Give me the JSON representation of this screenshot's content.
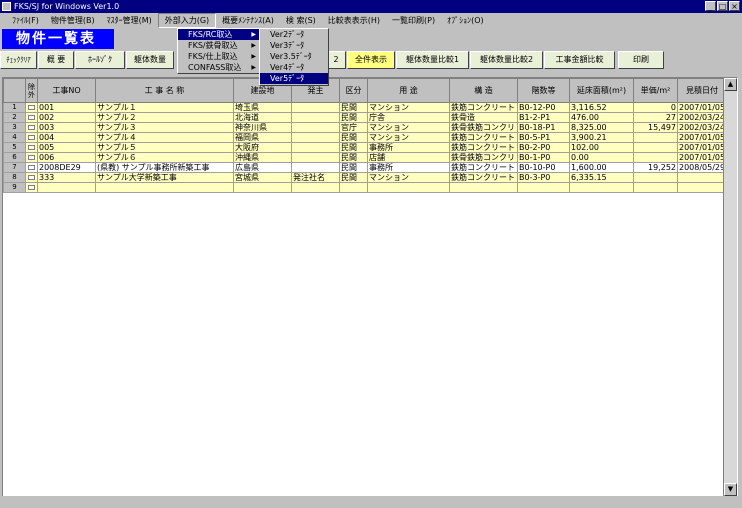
{
  "window": {
    "title": "FKS/SJ for Windows Ver1.0",
    "min": "_",
    "max": "□",
    "close": "×"
  },
  "menu": [
    "ﾌｧｲﾙ(F)",
    "物件管理(B)",
    "ﾏｽﾀｰ管理(M)",
    "外部入力(G)",
    "概要ﾒﾝﾃﾅﾝｽ(A)",
    "検 索(S)",
    "比較表表示(H)",
    "一覧印刷(P)",
    "ｵﾌﾟｼｮﾝ(O)"
  ],
  "page_title": "物件一覧表",
  "toolbar": {
    "b1": "ﾁｪｯｸｸﾘｱ",
    "b2": "概 要",
    "b3": "ﾎｰﾙｿﾞｸ",
    "b4": "躯体数量",
    "b5": "2",
    "b6": "全件表示",
    "b7": "躯体数量比較1",
    "b8": "躯体数量比較2",
    "b9": "工事金額比較",
    "b10": "印刷"
  },
  "dropdown1": [
    "FKS/RC取込",
    "FKS/鉄骨取込",
    "FKS/仕上取込",
    "CONFASS取込"
  ],
  "dropdown2": [
    "Ver2ﾃﾞｰﾀ",
    "Ver3ﾃﾞｰﾀ",
    "Ver3.5ﾃﾞｰﾀ",
    "Ver4ﾃﾞｰﾀ",
    "Ver5ﾃﾞｰﾀ"
  ],
  "columns": [
    "",
    "除外",
    "工事NO",
    "工 事 名 称",
    "建設地",
    "発主",
    "区分",
    "用 途",
    "構 造",
    "階数等",
    "延床面積(m²)",
    "単価/m²",
    "見積日付"
  ],
  "rows": [
    [
      "1",
      "001",
      "サンプル１",
      "埼玉県",
      "",
      "民間",
      "マンション",
      "鉄筋コンクリート",
      "B0-12-P0",
      "3,116.52",
      "0",
      "2007/01/05"
    ],
    [
      "2",
      "002",
      "サンプル２",
      "北海道",
      "",
      "民間",
      "庁舎",
      "鉄骨造",
      "B1-2-P1",
      "476.00",
      "27",
      "2002/03/24"
    ],
    [
      "3",
      "003",
      "サンプル３",
      "神奈川県",
      "",
      "官庁",
      "マンション",
      "鉄骨鉄筋コンクリ",
      "B0-18-P1",
      "8,325.00",
      "15,497",
      "2002/03/24"
    ],
    [
      "4",
      "004",
      "サンプル４",
      "福岡県",
      "",
      "民間",
      "マンション",
      "鉄筋コンクリート",
      "B0-5-P1",
      "3,900.21",
      "",
      "2007/01/05"
    ],
    [
      "5",
      "005",
      "サンプル５",
      "大阪府",
      "",
      "民間",
      "事務所",
      "鉄筋コンクリート",
      "B0-2-P0",
      "102.00",
      "",
      "2007/01/05"
    ],
    [
      "6",
      "006",
      "サンプル６",
      "沖縄県",
      "",
      "民間",
      "店舗",
      "鉄骨鉄筋コンクリ",
      "B0-1-P0",
      "0.00",
      "",
      "2007/01/05"
    ],
    [
      "7",
      "2008DE29",
      "(県教) サンプル事務所新築工事",
      "広島県",
      "",
      "民間",
      "事務所",
      "鉄筋コンクリート",
      "B0-10-P0",
      "1,600.00",
      "19,252",
      "2008/05/29"
    ],
    [
      "8",
      "333",
      "サンプル大学新築工事",
      "宮城県",
      "発注社名",
      "民間",
      "マンション",
      "鉄筋コンクリート",
      "B0-3-P0",
      "6,335.15",
      "",
      ""
    ],
    [
      "9",
      "",
      "",
      "",
      "",
      "",
      "",
      "",
      "",
      "",
      "",
      ""
    ]
  ]
}
